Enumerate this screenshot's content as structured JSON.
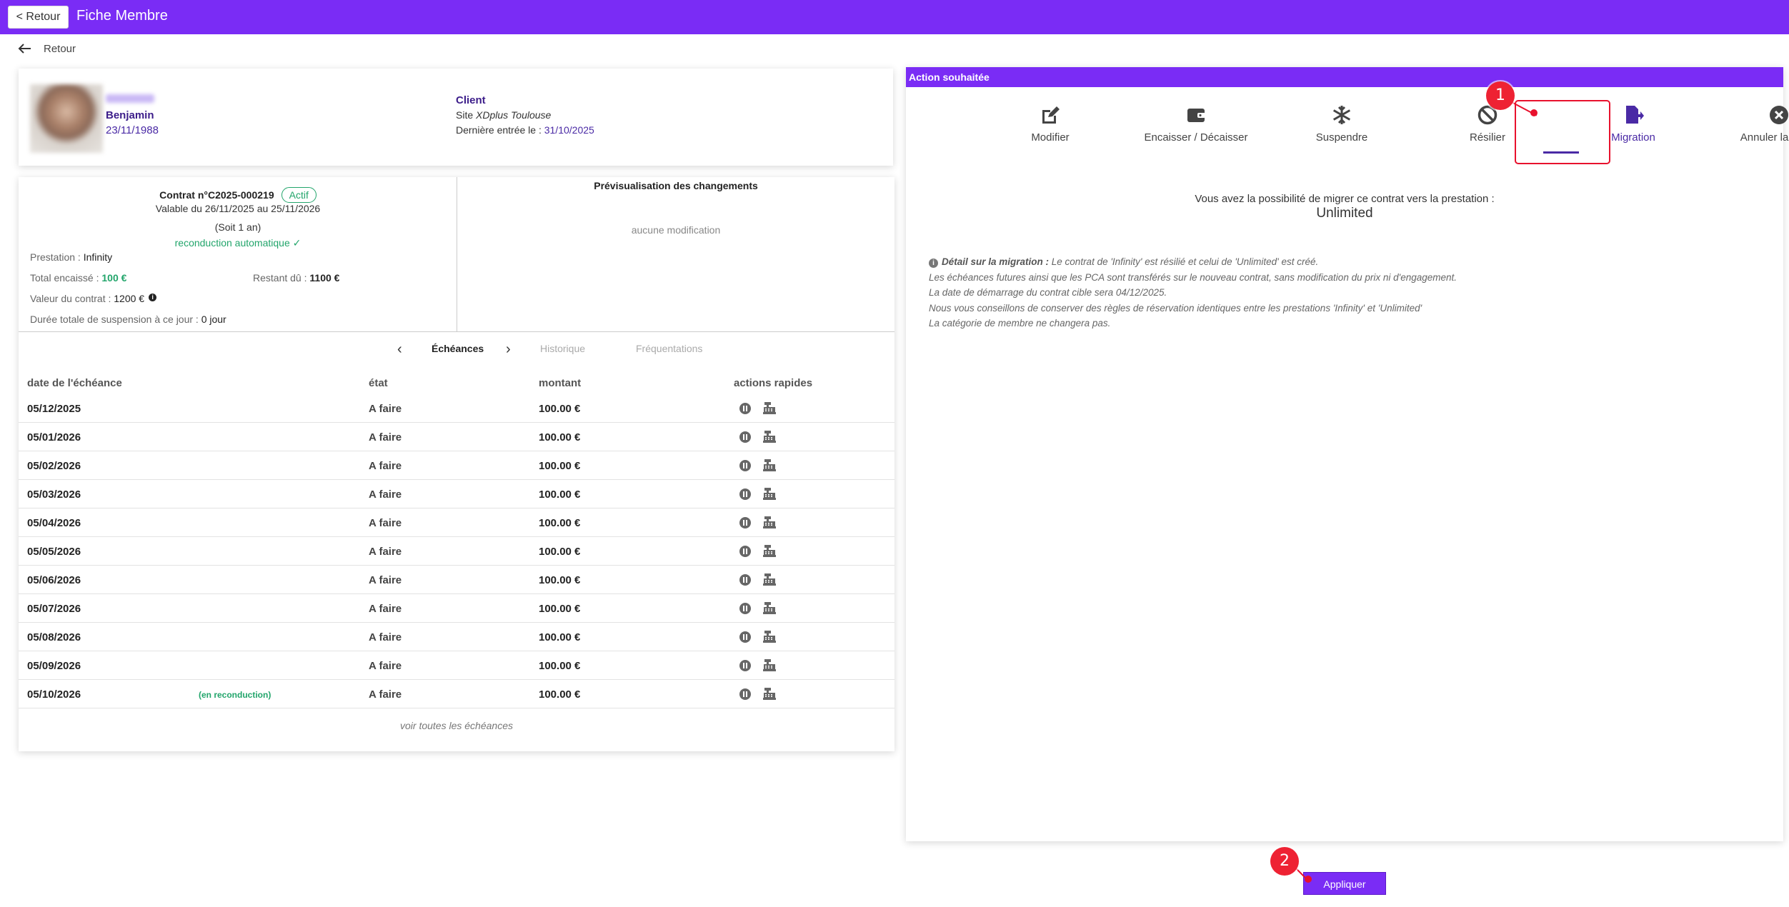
{
  "topbar": {
    "back_label": "< Retour",
    "title": "Fiche Membre"
  },
  "back_link": {
    "label": "Retour"
  },
  "member": {
    "first_name": "Benjamin",
    "birth_date": "23/11/1988",
    "status": "Client",
    "site_prefix": "Site ",
    "site_name": "XDplus Toulouse",
    "last_entry_label": "Dernière entrée le : ",
    "last_entry_value": "31/10/2025"
  },
  "contract": {
    "title": "Contrat n°C2025-000219",
    "status_badge": "Actif",
    "validity": "Valable du 26/11/2025 au 25/11/2026",
    "duration": "(Soit 1 an)",
    "renewal": "reconduction automatique ✓",
    "prestation_label": "Prestation : ",
    "prestation_value": "Infinity",
    "total_label": "Total encaissé : ",
    "total_value": "100 €",
    "remaining_label": "Restant dû : ",
    "remaining_value": "1100 €",
    "value_label": "Valeur du contrat : ",
    "value_value": "1200 €",
    "suspension_label": "Durée totale de suspension à ce jour : ",
    "suspension_value": "0 jour"
  },
  "preview": {
    "title": "Prévisualisation des changements",
    "empty": "aucune modification"
  },
  "tabs": {
    "active": "Échéances",
    "history": "Historique",
    "attendance": "Fréquentations"
  },
  "table": {
    "headers": {
      "date": "date de l'échéance",
      "state": "état",
      "amount": "montant",
      "actions": "actions rapides"
    },
    "rows": [
      {
        "date": "05/12/2025",
        "note": "",
        "state": "A faire",
        "amount": "100.00 €"
      },
      {
        "date": "05/01/2026",
        "note": "",
        "state": "A faire",
        "amount": "100.00 €"
      },
      {
        "date": "05/02/2026",
        "note": "",
        "state": "A faire",
        "amount": "100.00 €"
      },
      {
        "date": "05/03/2026",
        "note": "",
        "state": "A faire",
        "amount": "100.00 €"
      },
      {
        "date": "05/04/2026",
        "note": "",
        "state": "A faire",
        "amount": "100.00 €"
      },
      {
        "date": "05/05/2026",
        "note": "",
        "state": "A faire",
        "amount": "100.00 €"
      },
      {
        "date": "05/06/2026",
        "note": "",
        "state": "A faire",
        "amount": "100.00 €"
      },
      {
        "date": "05/07/2026",
        "note": "",
        "state": "A faire",
        "amount": "100.00 €"
      },
      {
        "date": "05/08/2026",
        "note": "",
        "state": "A faire",
        "amount": "100.00 €"
      },
      {
        "date": "05/09/2026",
        "note": "",
        "state": "A faire",
        "amount": "100.00 €"
      },
      {
        "date": "05/10/2026",
        "note": "(en reconduction)",
        "state": "A faire",
        "amount": "100.00 €"
      }
    ],
    "see_all": "voir toutes les échéances"
  },
  "actions": {
    "header": "Action souhaitée",
    "items": [
      {
        "label": "Modifier",
        "icon": "edit-icon"
      },
      {
        "label": "Encaisser / Décaisser",
        "icon": "wallet-icon"
      },
      {
        "label": "Suspendre",
        "icon": "snowflake-icon"
      },
      {
        "label": "Résilier",
        "icon": "ban-icon"
      },
      {
        "label": "Migration",
        "icon": "file-export-icon"
      },
      {
        "label": "Annuler la vente",
        "icon": "close-circle-icon"
      }
    ],
    "active": "Migration"
  },
  "migration": {
    "intro": "Vous avez la possibilité de migrer ce contrat vers la prestation :",
    "target": "Unlimited",
    "detail_title": "Détail sur la migration :",
    "detail_line1": " Le contrat de 'Infinity' est résilié et celui de 'Unlimited' est créé.",
    "detail_line2": "Les échéances futures ainsi que les PCA sont transférés sur le nouveau contrat, sans modification du prix ni d'engagement.",
    "detail_line3": "La date de démarrage du contrat cible sera 04/12/2025.",
    "detail_line4": "Nous vous conseillons de conserver des règles de réservation identiques entre les prestations 'Infinity' et 'Unlimited'",
    "detail_line5": "La catégorie de membre ne changera pas."
  },
  "apply_button": "Appliquer",
  "annotations": {
    "step1": "1",
    "step2": "2"
  },
  "colors": {
    "brand": "#7a2cf5",
    "accent_dark": "#4a2aa5",
    "success": "#22a56b",
    "annotation": "#e8112d"
  }
}
